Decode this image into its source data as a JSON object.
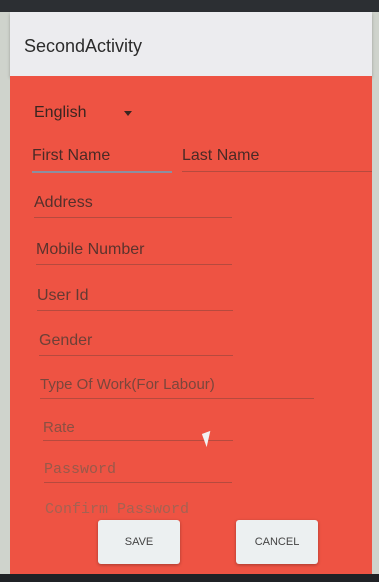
{
  "app": {
    "title": "SecondActivity"
  },
  "form": {
    "language": "English",
    "first_name": "First Name",
    "last_name": "Last Name",
    "address": "Address",
    "mobile": "Mobile Number",
    "user_id": "User Id",
    "gender": "Gender",
    "type_of_work": "Type Of Work(For Labour)",
    "rate": "Rate",
    "password": "Password",
    "confirm_password": "Confirm Password"
  },
  "buttons": {
    "save": "SAVE",
    "cancel": "CANCEL"
  },
  "colors": {
    "background": "#ee5343",
    "appbar": "#ececef"
  }
}
